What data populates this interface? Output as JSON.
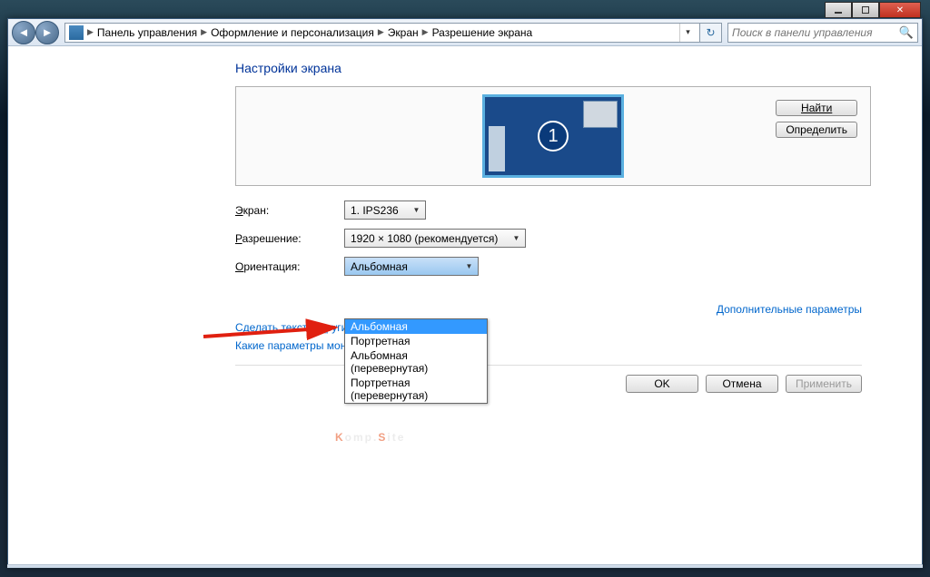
{
  "breadcrumb": {
    "items": [
      "Панель управления",
      "Оформление и персонализация",
      "Экран",
      "Разрешение экрана"
    ]
  },
  "search": {
    "placeholder": "Поиск в панели управления"
  },
  "heading": "Настройки экрана",
  "preview_buttons": {
    "find": "Найти",
    "detect": "Определить"
  },
  "labels": {
    "screen": "Экран:",
    "resolution": "Разрешение:",
    "orientation": "Ориентация:"
  },
  "screen_combo": "1. IPS236",
  "resolution_combo": "1920 × 1080 (рекомендуется)",
  "orientation_combo": "Альбомная",
  "orientation_options": [
    "Альбомная",
    "Портретная",
    "Альбомная (перевернутая)",
    "Портретная (перевернутая)"
  ],
  "more_link": "Дополнительные параметры",
  "text_link": "Сделать текст и другие",
  "help_link": "Какие параметры монитора следует выбрать?",
  "dialog_buttons": {
    "ok": "OK",
    "cancel": "Отмена",
    "apply": "Применить"
  },
  "monitor_number": "1",
  "watermark": {
    "part1": "K",
    "part2": "omp.",
    "part3": "S",
    "part4": "ite"
  }
}
